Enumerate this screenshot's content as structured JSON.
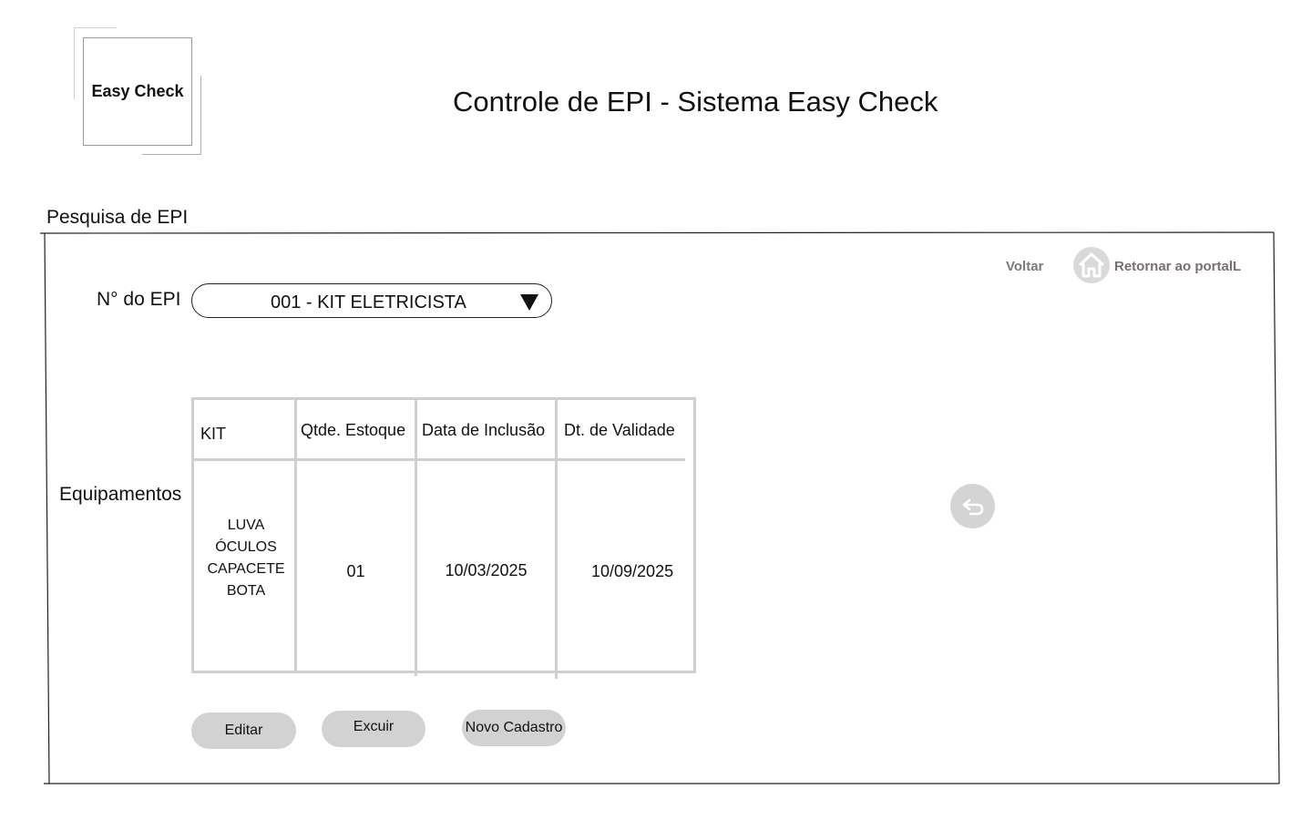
{
  "header": {
    "logo_text": "Easy Check",
    "title": "Controle de EPI - Sistema Easy Check"
  },
  "section": {
    "title": "Pesquisa de EPI"
  },
  "nav": {
    "back_label": "Voltar",
    "portal_label": "Retornar ao portalL",
    "home_icon": "home-icon",
    "undo_icon": "undo-icon"
  },
  "form": {
    "epi_label": "N° do EPI",
    "epi_selected": "001 - KIT ELETRICISTA",
    "equipamentos_label": "Equipamentos"
  },
  "table": {
    "headers": [
      "KIT",
      "Qtde. Estoque",
      "Data de Inclusão",
      "Dt. de Validade"
    ],
    "rows": [
      {
        "kit_items": [
          "LUVA",
          "ÓCULOS",
          "CAPACETE",
          "BOTA"
        ],
        "qtde": "01",
        "data_inclusao": "10/03/2025",
        "dt_validade": "10/09/2025"
      }
    ]
  },
  "actions": {
    "edit_label": "Editar",
    "delete_label": "Excuir",
    "new_label": "Novo Cadastro"
  },
  "colors": {
    "button_bg": "#d2d2d2",
    "table_border": "#cfcfcf",
    "link_gray": "#7a7a7a"
  }
}
